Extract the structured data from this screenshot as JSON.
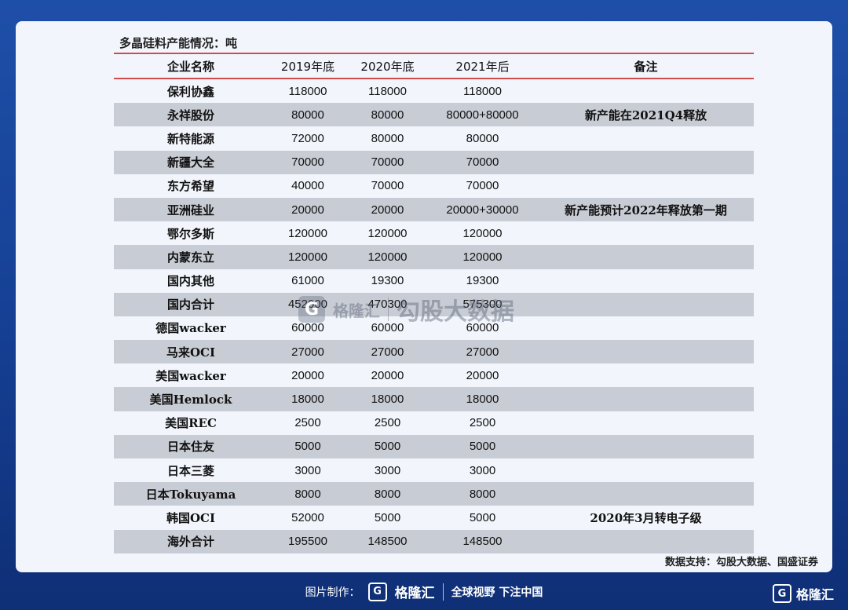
{
  "caption": "多晶硅料产能情况：吨",
  "table": {
    "headers": [
      "企业名称",
      "2019年底",
      "2020年底",
      "2021年后",
      "备注"
    ],
    "rows": [
      [
        "保利协鑫",
        "118000",
        "118000",
        "118000",
        ""
      ],
      [
        "永祥股份",
        "80000",
        "80000",
        "80000+80000",
        "新产能在2021Q4释放"
      ],
      [
        "新特能源",
        "72000",
        "80000",
        "80000",
        ""
      ],
      [
        "新疆大全",
        "70000",
        "70000",
        "70000",
        ""
      ],
      [
        "东方希望",
        "40000",
        "70000",
        "70000",
        ""
      ],
      [
        "亚洲硅业",
        "20000",
        "20000",
        "20000+30000",
        "新产能预计2022年释放第一期"
      ],
      [
        "鄂尔多斯",
        "120000",
        "120000",
        "120000",
        ""
      ],
      [
        "内蒙东立",
        "120000",
        "120000",
        "120000",
        ""
      ],
      [
        "国内其他",
        "61000",
        "19300",
        "19300",
        ""
      ],
      [
        "国内合计",
        "452000",
        "470300",
        "575300",
        ""
      ],
      [
        "德国wacker",
        "60000",
        "60000",
        "60000",
        ""
      ],
      [
        "马来OCI",
        "27000",
        "27000",
        "27000",
        ""
      ],
      [
        "美国wacker",
        "20000",
        "20000",
        "20000",
        ""
      ],
      [
        "美国Hemlock",
        "18000",
        "18000",
        "18000",
        ""
      ],
      [
        "美国REC",
        "2500",
        "2500",
        "2500",
        ""
      ],
      [
        "日本住友",
        "5000",
        "5000",
        "5000",
        ""
      ],
      [
        "日本三菱",
        "3000",
        "3000",
        "3000",
        ""
      ],
      [
        "日本Tokuyama",
        "8000",
        "8000",
        "8000",
        ""
      ],
      [
        "韩国OCI",
        "52000",
        "5000",
        "5000",
        "2020年3月转电子级"
      ],
      [
        "海外合计",
        "195500",
        "148500",
        "148500",
        ""
      ]
    ]
  },
  "source": "数据支持：勾股大数据、国盛证券",
  "watermark": {
    "logo_letter": "G",
    "brand": "格隆汇",
    "text": "勾股大数据"
  },
  "footer": {
    "label": "图片制作：",
    "logo_letter": "G",
    "brand": "格隆汇",
    "slogan": "全球视野 下注中国"
  },
  "corner": {
    "logo_letter": "G",
    "brand": "格隆汇"
  }
}
